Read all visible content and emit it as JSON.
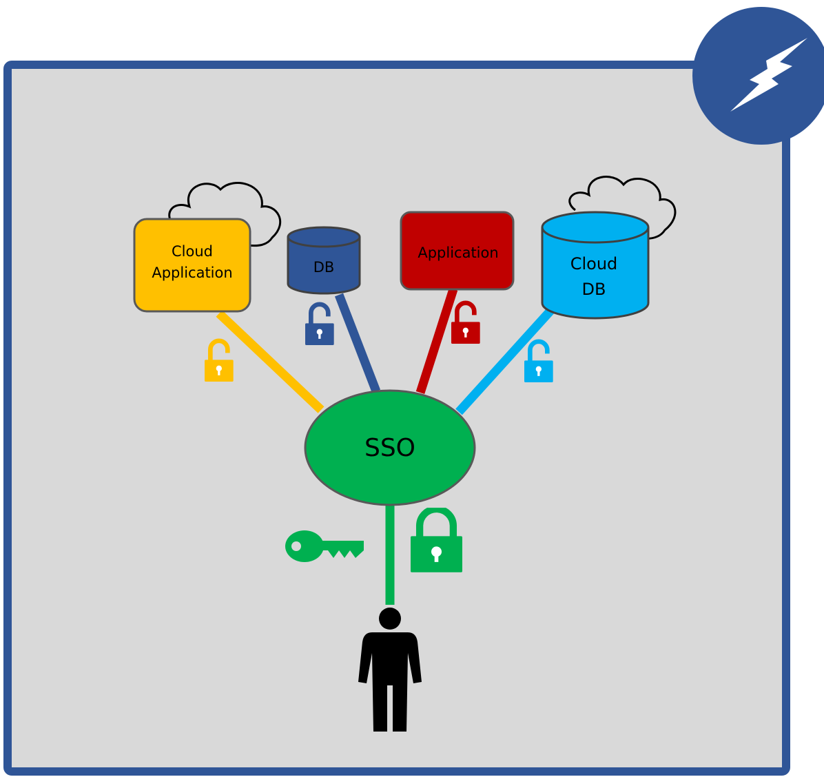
{
  "diagram": {
    "nodes": {
      "cloud_app": {
        "line1": "Cloud",
        "line2": "Application"
      },
      "db": {
        "label": "DB"
      },
      "app": {
        "label": "Application"
      },
      "cloud_db": {
        "line1": "Cloud",
        "line2": "DB"
      },
      "sso": {
        "label": "SSO"
      }
    },
    "colors": {
      "frame": "#2f5597",
      "background": "#d9d9d9",
      "yellow": "#ffc000",
      "blue": "#2f5597",
      "red": "#c00000",
      "light_blue": "#00b0f0",
      "green": "#00b050",
      "person": "#000000"
    },
    "icons": {
      "badge": "lightning-bolt-icon",
      "clouds": "cloud-outline-icon",
      "open_locks": "unlocked-padlock-icon",
      "closed_lock": "locked-padlock-icon",
      "key": "key-icon",
      "user": "person-icon"
    }
  }
}
